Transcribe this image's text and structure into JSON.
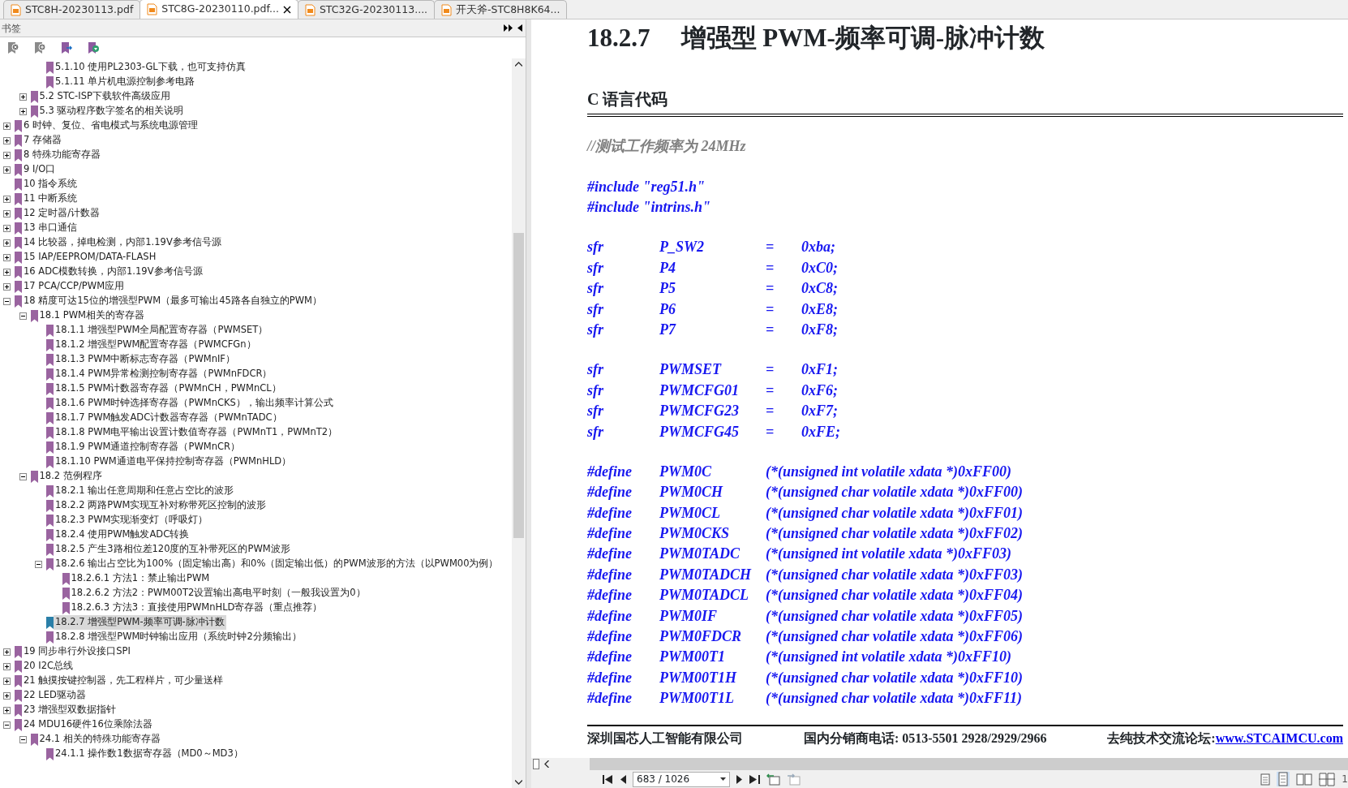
{
  "tabs": [
    {
      "label": "STC8H-20230113.pdf",
      "selected": false
    },
    {
      "label": "STC8G-20230110.pdf...",
      "selected": true
    },
    {
      "label": "STC32G-20230113....",
      "selected": false
    },
    {
      "label": "开天斧-STC8H8K64...",
      "selected": false
    }
  ],
  "bookmarks": {
    "title": "书签",
    "tree": [
      {
        "children": [
          {
            "children": [
              {
                "label": "5.1.10 使用PL2303-GL下载，也可支持仿真",
                "selected": false
              },
              {
                "label": "5.1.11 单片机电源控制参考电路",
                "selected": false
              }
            ]
          },
          {
            "label": "5.2 STC-ISP下载软件高级应用",
            "expanded": false,
            "selected": false
          },
          {
            "label": "5.3 驱动程序数字签名的相关说明",
            "expanded": false,
            "selected": false
          }
        ]
      },
      {
        "label": "6 时钟、复位、省电模式与系统电源管理",
        "expanded": false,
        "selected": false
      },
      {
        "label": "7 存储器",
        "expanded": false,
        "selected": false
      },
      {
        "label": "8 特殊功能寄存器",
        "expanded": false,
        "selected": false
      },
      {
        "label": "9 I/O口",
        "expanded": false,
        "selected": false
      },
      {
        "label": "10 指令系统",
        "selected": false
      },
      {
        "label": "11 中断系统",
        "expanded": false,
        "selected": false
      },
      {
        "label": "12 定时器/计数器",
        "expanded": false,
        "selected": false
      },
      {
        "label": "13 串口通信",
        "expanded": false,
        "selected": false
      },
      {
        "label": "14 比较器，掉电检测，内部1.19V参考信号源",
        "expanded": false,
        "selected": false
      },
      {
        "label": "15 IAP/EEPROM/DATA-FLASH",
        "expanded": false,
        "selected": false
      },
      {
        "label": "16 ADC模数转换，内部1.19V参考信号源",
        "expanded": false,
        "selected": false
      },
      {
        "label": "17 PCA/CCP/PWM应用",
        "expanded": false,
        "selected": false
      },
      {
        "label": "18 精度可达15位的增强型PWM（最多可输出45路各自独立的PWM）",
        "expanded": true,
        "selected": false,
        "children": [
          {
            "label": "18.1 PWM相关的寄存器",
            "expanded": true,
            "selected": false,
            "children": [
              {
                "label": "18.1.1 增强型PWM全局配置寄存器（PWMSET）",
                "selected": false
              },
              {
                "label": "18.1.2 增强型PWM配置寄存器（PWMCFGn）",
                "selected": false
              },
              {
                "label": "18.1.3 PWM中断标志寄存器（PWMnIF）",
                "selected": false
              },
              {
                "label": "18.1.4 PWM异常检测控制寄存器（PWMnFDCR）",
                "selected": false
              },
              {
                "label": "18.1.5 PWM计数器寄存器（PWMnCH，PWMnCL）",
                "selected": false
              },
              {
                "label": "18.1.6 PWM时钟选择寄存器（PWMnCKS），输出频率计算公式",
                "selected": false
              },
              {
                "label": "18.1.7 PWM触发ADC计数器寄存器（PWMnTADC）",
                "selected": false
              },
              {
                "label": "18.1.8 PWM电平输出设置计数值寄存器（PWMnT1，PWMnT2）",
                "selected": false
              },
              {
                "label": "18.1.9 PWM通道控制寄存器（PWMnCR）",
                "selected": false
              },
              {
                "label": "18.1.10 PWM通道电平保持控制寄存器（PWMnHLD）",
                "selected": false
              }
            ]
          },
          {
            "label": "18.2 范例程序",
            "expanded": true,
            "selected": false,
            "children": [
              {
                "label": "18.2.1 输出任意周期和任意占空比的波形",
                "selected": false
              },
              {
                "label": "18.2.2 两路PWM实现互补对称带死区控制的波形",
                "selected": false
              },
              {
                "label": "18.2.3 PWM实现渐变灯（呼吸灯）",
                "selected": false
              },
              {
                "label": "18.2.4 使用PWM触发ADC转换",
                "selected": false
              },
              {
                "label": "18.2.5 产生3路相位差120度的互补带死区的PWM波形",
                "selected": false
              },
              {
                "label": "18.2.6 输出占空比为100%（固定输出高）和0%（固定输出低）的PWM波形的方法（以PWM00为例）",
                "expanded": true,
                "selected": false,
                "children": [
                  {
                    "label": "18.2.6.1 方法1：禁止输出PWM",
                    "selected": false
                  },
                  {
                    "label": "18.2.6.2 方法2：PWM00T2设置输出高电平时刻（一般我设置为0）",
                    "selected": false
                  },
                  {
                    "label": "18.2.6.3 方法3：直接使用PWMnHLD寄存器（重点推荐）",
                    "selected": false
                  }
                ]
              },
              {
                "label": "18.2.7 增强型PWM-频率可调-脉冲计数",
                "selected": true
              },
              {
                "label": "18.2.8 增强型PWM时钟输出应用（系统时钟2分频输出）",
                "selected": false
              }
            ]
          }
        ]
      },
      {
        "label": "19 同步串行外设接口SPI",
        "expanded": false,
        "selected": false
      },
      {
        "label": "20 I2C总线",
        "expanded": false,
        "selected": false
      },
      {
        "label": "21 触摸按键控制器，先工程样片，可少量送样",
        "expanded": false,
        "selected": false
      },
      {
        "label": "22 LED驱动器",
        "expanded": false,
        "selected": false
      },
      {
        "label": "23 增强型双数据指针",
        "expanded": false,
        "selected": false
      },
      {
        "label": "24 MDU16硬件16位乘除法器",
        "expanded": true,
        "selected": false,
        "children": [
          {
            "label": "24.1 相关的特殊功能寄存器",
            "expanded": true,
            "selected": false,
            "children": [
              {
                "label": "24.1.1 操作数1数据寄存器（MD0～MD3）",
                "selected": false
              }
            ]
          }
        ]
      }
    ]
  },
  "page": {
    "section_number": "18.2.7",
    "heading": "增强型 PWM-频率可调-脉冲计数",
    "subheading": "C 语言代码",
    "code_blocks": [
      {
        "lines": [
          {
            "kind": "comment",
            "cells": [
              "//测试工作频率为 24MHz"
            ]
          }
        ]
      },
      {
        "lines": [
          {
            "kind": "include",
            "cells": [
              "#include \"reg51.h\""
            ]
          },
          {
            "kind": "include",
            "cells": [
              "#include \"intrins.h\""
            ]
          }
        ]
      },
      {
        "lines": [
          {
            "kind": "sfr",
            "cells": [
              "sfr",
              "P_SW2",
              "=",
              "0xba;"
            ]
          },
          {
            "kind": "sfr",
            "cells": [
              "sfr",
              "P4",
              "=",
              "0xC0;"
            ]
          },
          {
            "kind": "sfr",
            "cells": [
              "sfr",
              "P5",
              "=",
              "0xC8;"
            ]
          },
          {
            "kind": "sfr",
            "cells": [
              "sfr",
              "P6",
              "=",
              "0xE8;"
            ]
          },
          {
            "kind": "sfr",
            "cells": [
              "sfr",
              "P7",
              "=",
              "0xF8;"
            ]
          }
        ]
      },
      {
        "lines": [
          {
            "kind": "sfr",
            "cells": [
              "sfr",
              "PWMSET",
              "=",
              "0xF1;"
            ]
          },
          {
            "kind": "sfr",
            "cells": [
              "sfr",
              "PWMCFG01",
              "=",
              "0xF6;"
            ]
          },
          {
            "kind": "sfr",
            "cells": [
              "sfr",
              "PWMCFG23",
              "=",
              "0xF7;"
            ]
          },
          {
            "kind": "sfr",
            "cells": [
              "sfr",
              "PWMCFG45",
              "=",
              "0xFE;"
            ]
          }
        ]
      },
      {
        "lines": [
          {
            "kind": "define",
            "cells": [
              "#define",
              "PWM0C",
              "(*(unsigned int volatile xdata *)0xFF00)"
            ]
          },
          {
            "kind": "define",
            "cells": [
              "#define",
              "PWM0CH",
              "(*(unsigned char volatile xdata *)0xFF00)"
            ]
          },
          {
            "kind": "define",
            "cells": [
              "#define",
              "PWM0CL",
              "(*(unsigned char volatile xdata *)0xFF01)"
            ]
          },
          {
            "kind": "define",
            "cells": [
              "#define",
              "PWM0CKS",
              "(*(unsigned char volatile xdata *)0xFF02)"
            ]
          },
          {
            "kind": "define",
            "cells": [
              "#define",
              "PWM0TADC",
              "(*(unsigned int volatile xdata *)0xFF03)"
            ]
          },
          {
            "kind": "define",
            "cells": [
              "#define",
              "PWM0TADCH",
              "(*(unsigned char volatile xdata *)0xFF03)"
            ]
          },
          {
            "kind": "define",
            "cells": [
              "#define",
              "PWM0TADCL",
              "(*(unsigned char volatile xdata *)0xFF04)"
            ]
          },
          {
            "kind": "define",
            "cells": [
              "#define",
              "PWM0IF",
              "(*(unsigned char volatile xdata *)0xFF05)"
            ]
          },
          {
            "kind": "define",
            "cells": [
              "#define",
              "PWM0FDCR",
              "(*(unsigned char volatile xdata *)0xFF06)"
            ]
          },
          {
            "kind": "define",
            "cells": [
              "#define",
              "PWM00T1",
              "(*(unsigned int volatile xdata *)0xFF10)"
            ]
          },
          {
            "kind": "define",
            "cells": [
              "#define",
              "PWM00T1H",
              "(*(unsigned char volatile xdata *)0xFF10)"
            ]
          },
          {
            "kind": "define",
            "cells": [
              "#define",
              "PWM00T1L",
              "(*(unsigned char volatile xdata *)0xFF11)"
            ]
          }
        ]
      }
    ],
    "footer": {
      "company": "深圳国芯人工智能有限公司",
      "phone": "国内分销商电话: 0513-5501 2928/2929/2966",
      "forum_label": "去纯技术交流论坛:",
      "forum_link": "www.STCAIMCU.com"
    }
  },
  "navigation": {
    "page_field": "683 / 1026",
    "zoom_value": "1"
  }
}
